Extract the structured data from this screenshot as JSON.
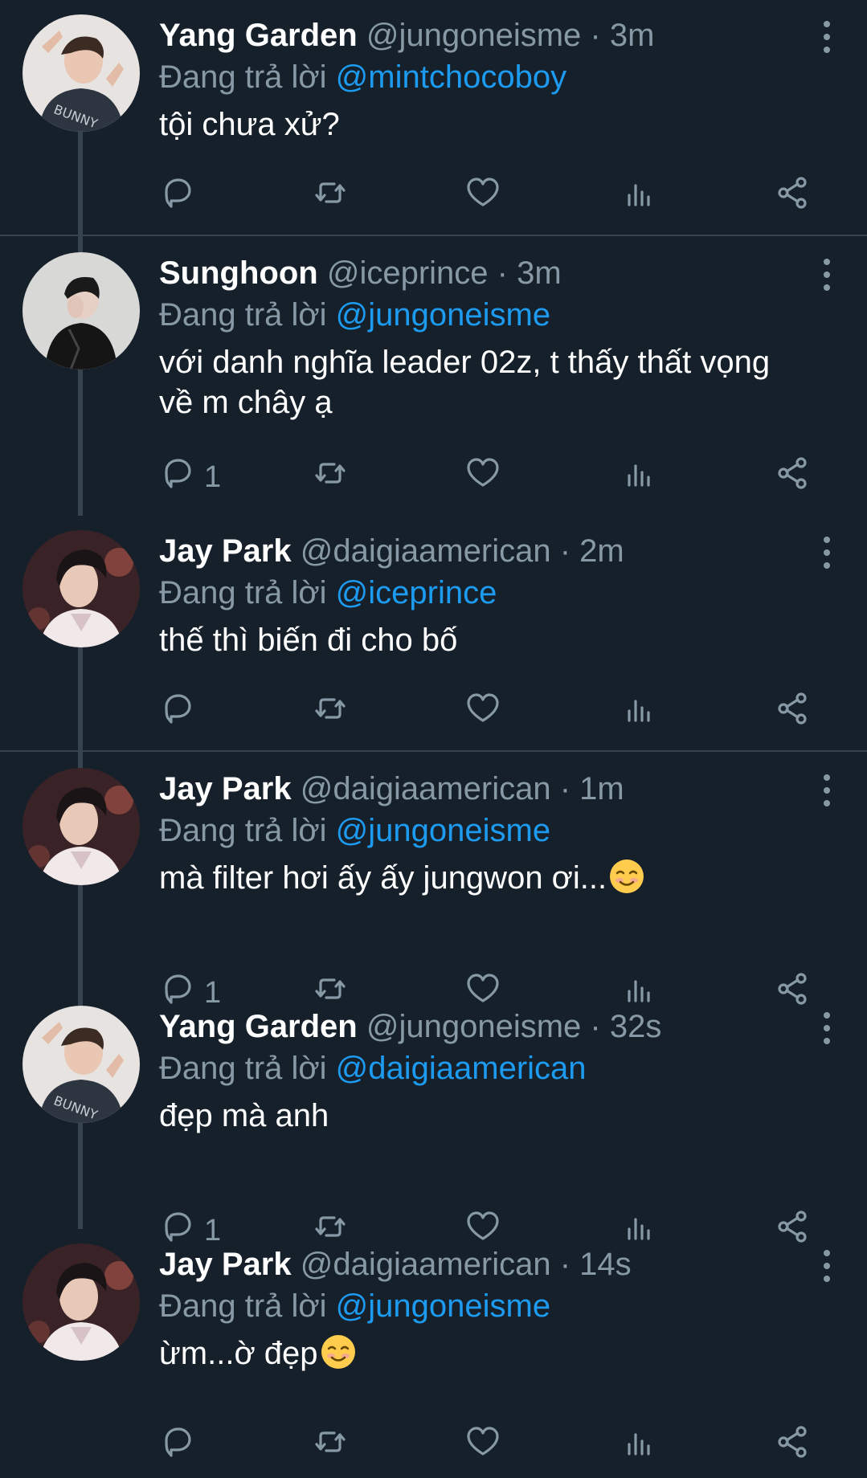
{
  "theme": {
    "background": "#15202b",
    "text": "#ffffff",
    "muted": "#8899a6",
    "link": "#1d9bf0",
    "divider": "#38444d"
  },
  "reply_prefix": "Đang trả lời",
  "tweets": [
    {
      "name": "Yang Garden",
      "handle": "@jungoneisme",
      "time": "· 3m",
      "reply_to": "@mintchocoboy",
      "text": "tội chưa xử?",
      "emoji": "",
      "reply_count": "",
      "avatar": "yang"
    },
    {
      "name": "Sunghoon",
      "handle": "@iceprince",
      "time": "· 3m",
      "reply_to": "@jungoneisme",
      "text": "với danh nghĩa leader 02z, t thấy thất vọng về m chây ạ",
      "emoji": "",
      "reply_count": "1",
      "avatar": "sunghoon"
    },
    {
      "name": "Jay Park",
      "handle": "@daigiaamerican",
      "time": "· 2m",
      "reply_to": "@iceprince",
      "text": "thế thì biến đi cho bố",
      "emoji": "",
      "reply_count": "",
      "avatar": "jay"
    },
    {
      "name": "Jay Park",
      "handle": "@daigiaamerican",
      "time": "· 1m",
      "reply_to": "@jungoneisme",
      "text": "mà filter hơi ấy ấy jungwon ơi...",
      "emoji": "smiling-face-icon",
      "reply_count": "1",
      "avatar": "jay"
    },
    {
      "name": "Yang Garden",
      "handle": "@jungoneisme",
      "time": "· 32s",
      "reply_to": "@daigiaamerican",
      "text": "đẹp mà anh",
      "emoji": "",
      "reply_count": "1",
      "avatar": "yang"
    },
    {
      "name": "Jay Park",
      "handle": "@daigiaamerican",
      "time": "· 14s",
      "reply_to": "@jungoneisme",
      "text": "ừm...ờ đẹp",
      "emoji": "smiling-face-icon",
      "reply_count": "",
      "avatar": "jay"
    }
  ],
  "action_icons": [
    "reply-icon",
    "retweet-icon",
    "like-icon",
    "analytics-icon",
    "share-icon"
  ]
}
